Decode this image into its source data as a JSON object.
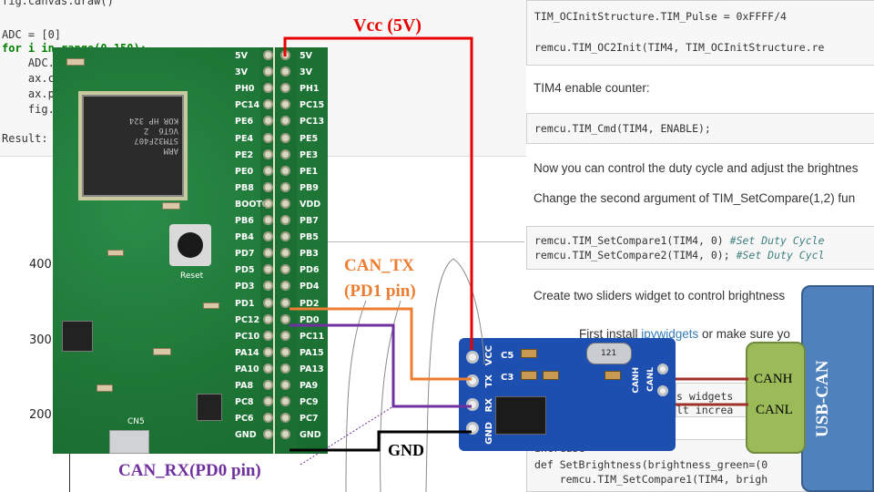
{
  "notebook_left": {
    "code_lines": [
      "fig.canvas.draw()",
      "",
      "ADC = [0]",
      "for i in range(0,150):",
      "    ADC.",
      "    ax.c",
      "    ax.p",
      "    fig."
    ],
    "result_label": "Result:",
    "plot_yticks": [
      "400",
      "300",
      "200"
    ]
  },
  "notebook_right": {
    "cell1_line1": "TIM_OCInitStructure.TIM_Pulse = 0xFFFF/4",
    "cell1_line2": "remcu.TIM_OC2Init(TIM4, TIM_OCInitStructure.re",
    "md1": "TIM4 enable counter:",
    "cell2": "remcu.TIM_Cmd(TIM4, ENABLE);",
    "md2": "Now you can control the duty cycle and adjust the brightnes",
    "md3": "Change the second argument of TIM_SetCompare(1,2) fun",
    "cell3_line1_code": "remcu.TIM_SetCompare1(TIM4, 0) ",
    "cell3_line1_comment": "#Set Duty Cycle",
    "cell3_line2_code": "remcu.TIM_SetCompare2(TIM4, 0); ",
    "cell3_line2_comment": "#Set Duty Cycl",
    "md4": "Create two sliders widget to control brightness",
    "md5_prefix": "First install ",
    "md5_link": "ipywidgets",
    "md5_suffix": " or make sure yo",
    "cell4_frag1": "s widgets",
    "cell4_frag2": "lt increa",
    "cell5_frag": "increase",
    "cell5_line1": "def SetBrightness(brightness_green=(0",
    "cell5_line2": "    remcu.TIM_SetCompare1(TIM4, brigh"
  },
  "board": {
    "mcu_text": "ARM\nSTM32F407\nVGT6  Z\nKOR HP 324",
    "reset_label": "Reset",
    "usb_label": "CN5",
    "left_pins": [
      "5V",
      "3V",
      "PH0",
      "PC14",
      "PE6",
      "PE4",
      "PE2",
      "PE0",
      "PB8",
      "BOOT0",
      "PB6",
      "PB4",
      "PD7",
      "PD5",
      "PD3",
      "PD1",
      "PC12",
      "PC10",
      "PA14",
      "PA10",
      "PA8",
      "PC8",
      "PC6",
      "GND"
    ],
    "right_pins": [
      "5V",
      "3V",
      "PH1",
      "PC15",
      "PC13",
      "PE5",
      "PE3",
      "PE1",
      "PB9",
      "VDD",
      "PB7",
      "PB5",
      "PB3",
      "PD6",
      "PD4",
      "PD2",
      "PD0",
      "PC11",
      "PA15",
      "PA13",
      "PA9",
      "PC9",
      "PC7",
      "GND"
    ]
  },
  "can_module": {
    "pin_labels": [
      "VCC",
      "TX",
      "RX",
      "GND"
    ],
    "cap_labels": [
      "C5",
      "C3"
    ],
    "chip_label": "121",
    "can_pins": [
      "CANH",
      "CANL"
    ]
  },
  "usb_can": {
    "title": "USB-CAN",
    "canh": "CANH",
    "canl": "CANL"
  },
  "annotations": {
    "vcc": "Vcc (5V)",
    "can_tx_line1": "CAN_TX",
    "can_tx_line2": "(PD1 pin)",
    "gnd": "GND",
    "can_rx": "CAN_RX(PD0  pin)"
  },
  "colors": {
    "vcc_wire": "#e60000",
    "tx_wire": "#ed7d31",
    "rx_wire": "#7030a0",
    "gnd_wire": "#000000",
    "can_wire": "#a0302a",
    "board_green": "#1f7a3a",
    "module_blue": "#1d4fb0",
    "usbcan_blue": "#4f81bd",
    "usbcan_green": "#9bbb59"
  }
}
